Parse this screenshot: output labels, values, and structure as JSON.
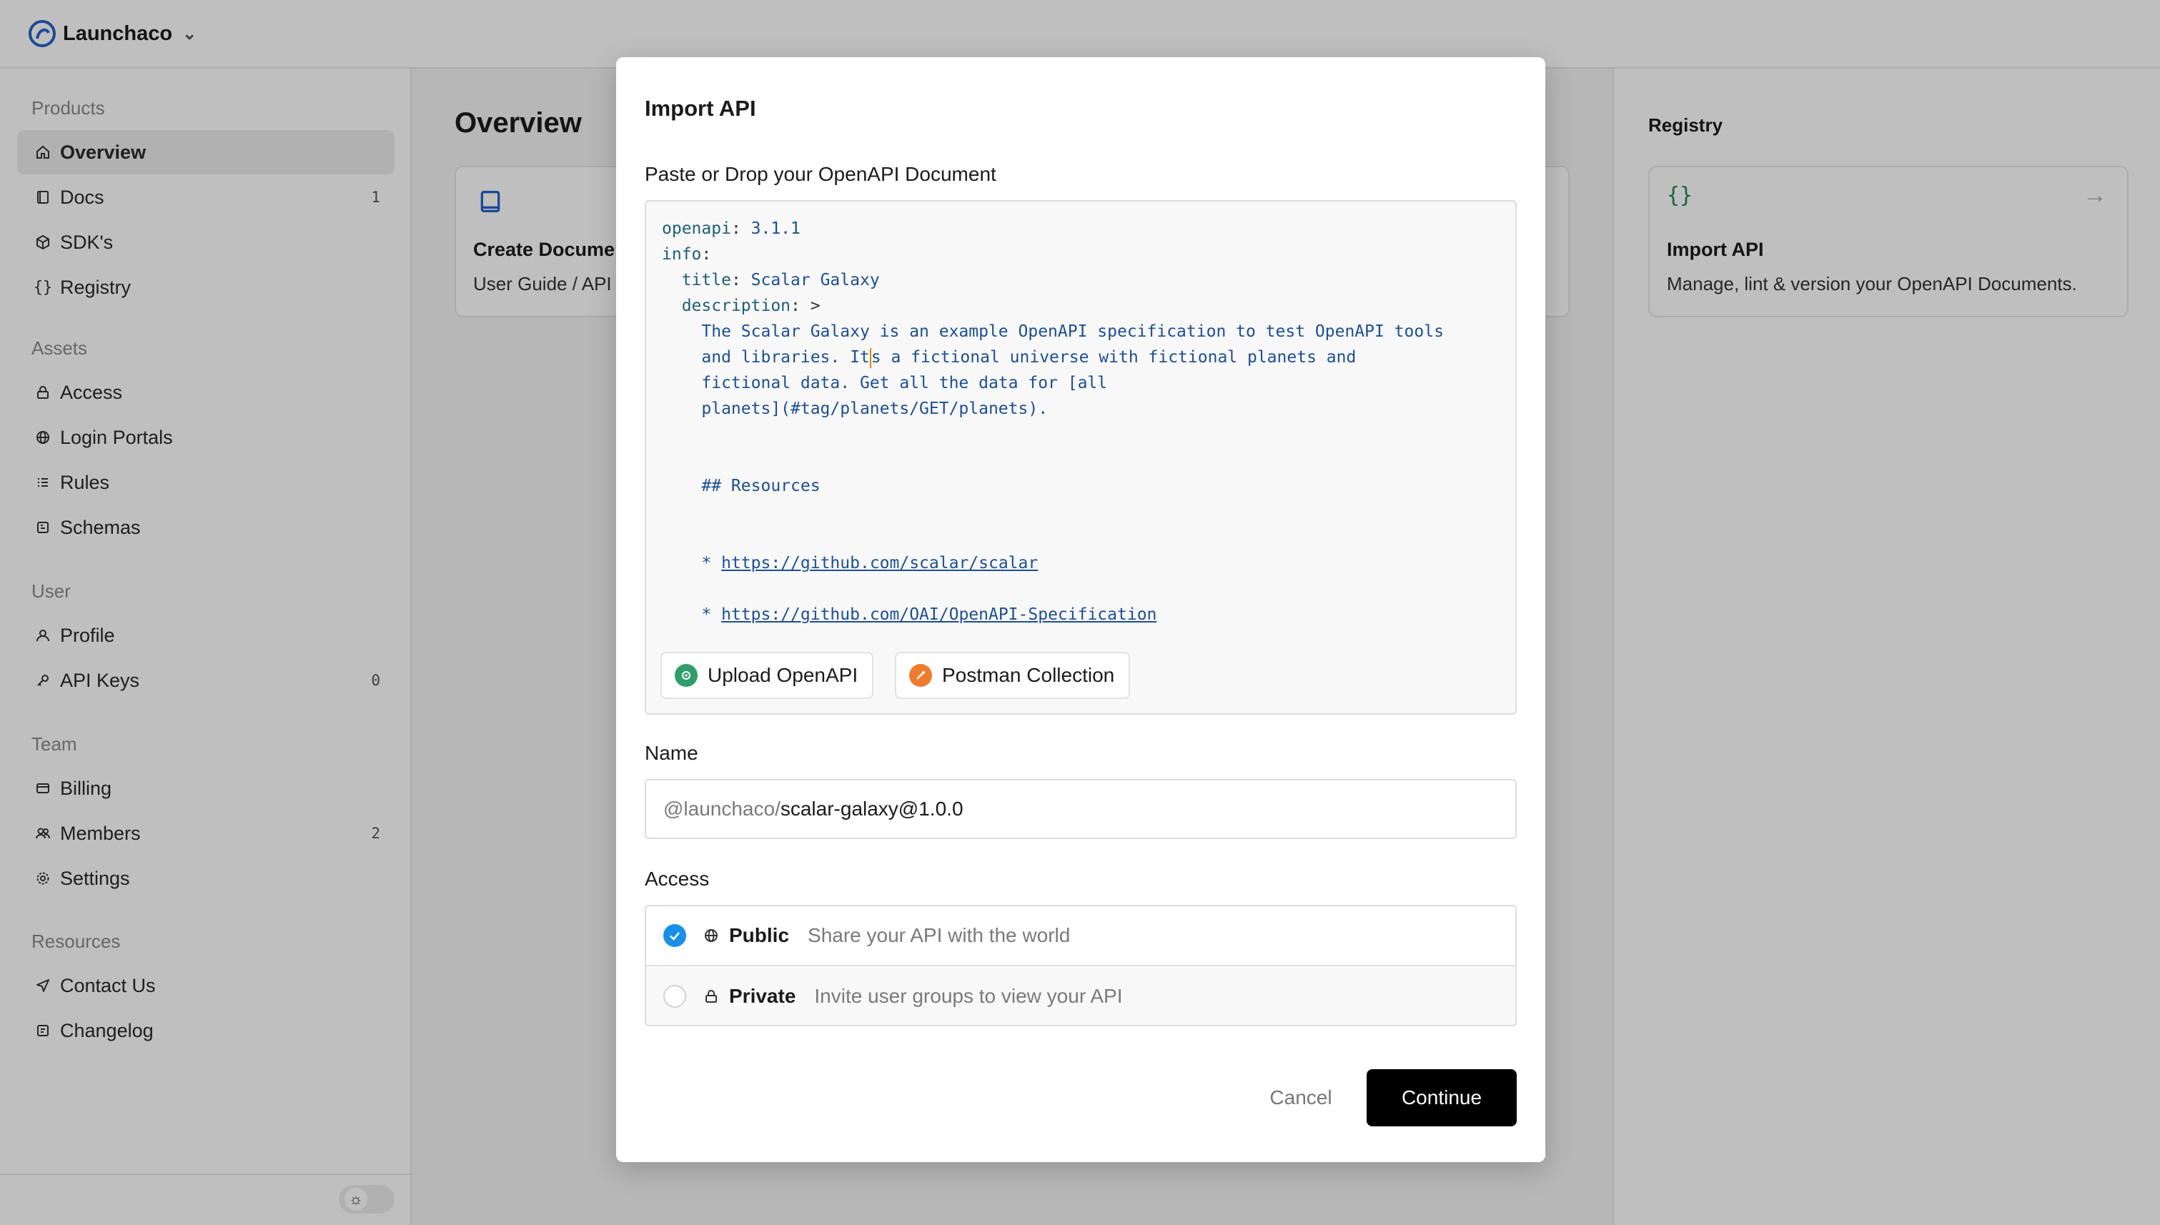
{
  "app": {
    "name": "Launchaco"
  },
  "sidebar": {
    "groups": [
      {
        "title": "Products",
        "items": [
          {
            "label": "Overview",
            "icon": "home-icon",
            "active": true
          },
          {
            "label": "Docs",
            "icon": "book-icon",
            "count": "1"
          },
          {
            "label": "SDK's",
            "icon": "package-icon"
          },
          {
            "label": "Registry",
            "icon": "braces-icon"
          }
        ]
      },
      {
        "title": "Assets",
        "items": [
          {
            "label": "Access",
            "icon": "lock-icon"
          },
          {
            "label": "Login Portals",
            "icon": "globe-icon"
          },
          {
            "label": "Rules",
            "icon": "list-icon"
          },
          {
            "label": "Schemas",
            "icon": "schema-icon"
          }
        ]
      },
      {
        "title": "User",
        "items": [
          {
            "label": "Profile",
            "icon": "user-icon"
          },
          {
            "label": "API Keys",
            "icon": "key-icon",
            "count": "0"
          }
        ]
      },
      {
        "title": "Team",
        "items": [
          {
            "label": "Billing",
            "icon": "card-icon"
          },
          {
            "label": "Members",
            "icon": "users-icon",
            "count": "2"
          },
          {
            "label": "Settings",
            "icon": "gear-icon"
          }
        ]
      },
      {
        "title": "Resources",
        "items": [
          {
            "label": "Contact Us",
            "icon": "send-icon"
          },
          {
            "label": "Changelog",
            "icon": "changelog-icon"
          }
        ]
      }
    ]
  },
  "main": {
    "title": "Overview",
    "card": {
      "title": "Create Documer",
      "desc": "User Guide / API"
    }
  },
  "registry": {
    "title": "Registry",
    "card": {
      "title": "Import API",
      "desc": "Manage, lint & version your OpenAPI Documents."
    }
  },
  "modal": {
    "title": "Import API",
    "document_label": "Paste or Drop your OpenAPI Document",
    "code": {
      "l1_key": "openapi",
      "l1_val": "3.1.1",
      "l2_key": "info",
      "l3_key": "title",
      "l3_val": "Scalar Galaxy",
      "l4_key": "description",
      "l4_val": ">",
      "l5": "The Scalar Galaxy is an example OpenAPI specification to test OpenAPI tools",
      "l6a": "and libraries. It",
      "l6b": "s a fictional universe with fictional planets and",
      "l7": "fictional data. Get all the data for [all",
      "l8": "planets](#tag/planets/GET/planets).",
      "l9": "## Resources",
      "bullet": "*",
      "link1": "https://github.com/scalar/scalar",
      "link2": "https://github.com/OAI/OpenAPI-Specification"
    },
    "upload_openapi": "Upload OpenAPI",
    "postman_collection": "Postman Collection",
    "name_label": "Name",
    "name_prefix": "@launchaco/",
    "name_value": "scalar-galaxy@1.0.0",
    "access_label": "Access",
    "access_options": [
      {
        "label": "Public",
        "desc": "Share your API with the world",
        "selected": true
      },
      {
        "label": "Private",
        "desc": "Invite user groups to view your API",
        "selected": false
      }
    ],
    "cancel": "Cancel",
    "continue": "Continue"
  },
  "colors": {
    "accent": "#1a8fe8",
    "primary_button": "#000000",
    "registry_icon": "#1f8a5a"
  }
}
